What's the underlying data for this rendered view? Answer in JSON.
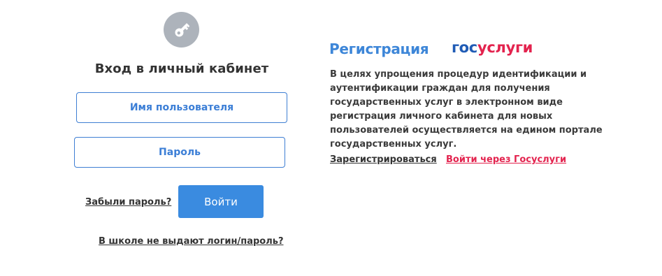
{
  "login": {
    "title": "Вход в личный кабинет",
    "username_placeholder": "Имя пользователя",
    "password_placeholder": "Пароль",
    "forgot_label": "Забыли пароль?",
    "submit_label": "Войти",
    "no_login_label": "В школе не выдают логин/пароль?",
    "icon": "key-icon"
  },
  "registration": {
    "title": "Регистрация",
    "logo_part1": "гос",
    "logo_part2": "услуги",
    "description": "В целях упрощения процедур идентификации и аутентификации граждан для получения государственных услуг в электронном виде регистрация личного кабинета для новых пользователей осуществляется на едином портале государственных услуг.",
    "register_label": "Зарегистрироваться",
    "gosuslugi_label": "Войти через Госуслуги"
  },
  "colors": {
    "accent_blue": "#3a8be0",
    "field_border": "#3f7fd3",
    "logo_blue": "#1f5bb5",
    "logo_red": "#e3234e",
    "icon_grey": "#adb3bb"
  }
}
